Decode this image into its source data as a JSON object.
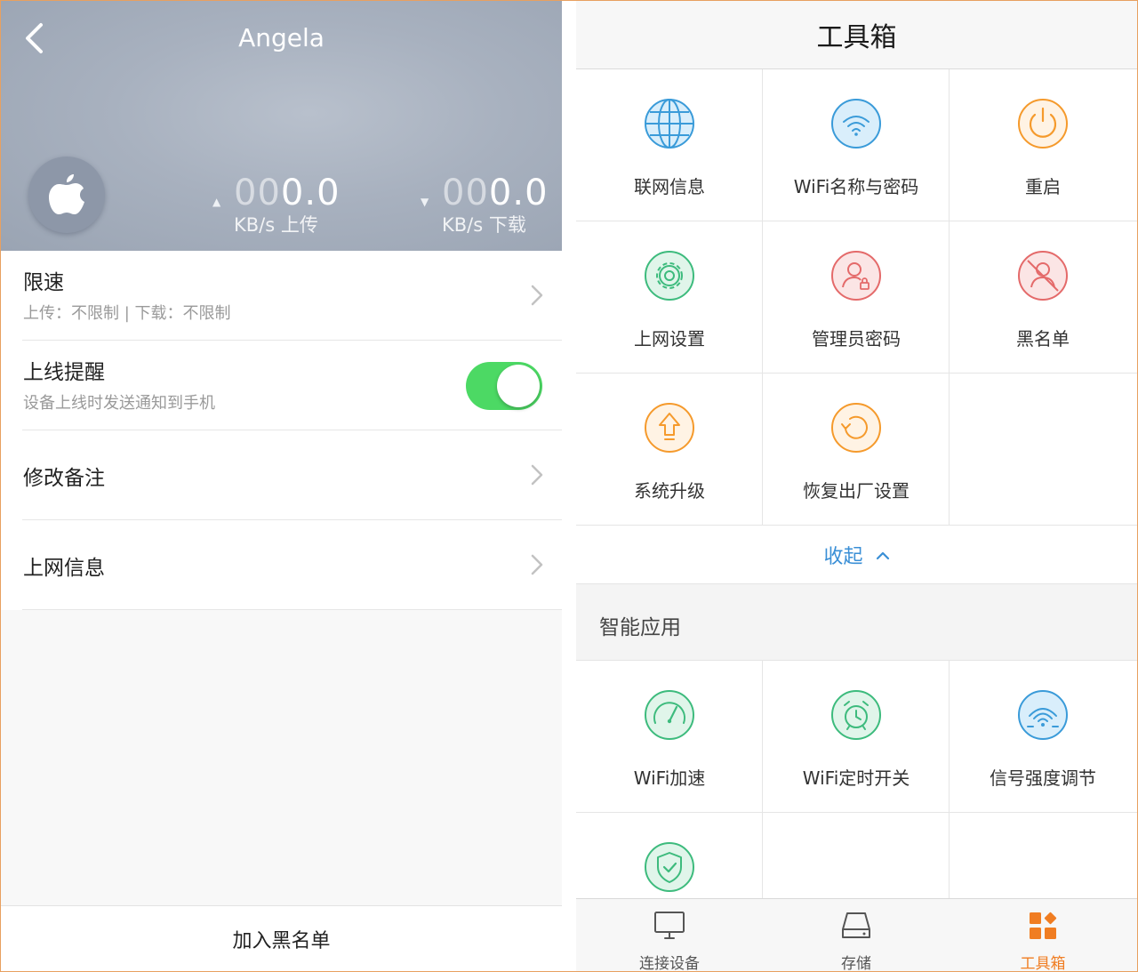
{
  "device_panel": {
    "title": "Angela",
    "upload": {
      "value_dim": "00",
      "value_main": "0.0",
      "unit": "KB/s 上传"
    },
    "download": {
      "value_dim": "00",
      "value_main": "0.0",
      "unit": "KB/s 下载"
    },
    "rows": {
      "speed_limit": {
        "title": "限速",
        "subtitle": "上传：不限制 | 下载：不限制"
      },
      "online_alert": {
        "title": "上线提醒",
        "subtitle": "设备上线时发送通知到手机",
        "enabled": true
      },
      "edit_note": {
        "title": "修改备注"
      },
      "net_info": {
        "title": "上网信息"
      }
    },
    "bottom_action": "加入黑名单"
  },
  "toolbox": {
    "title": "工具箱",
    "tools": [
      {
        "label": "联网信息",
        "icon": "globe-icon",
        "color": "#3a9bd9"
      },
      {
        "label": "WiFi名称与密码",
        "icon": "wifi-icon",
        "color": "#3a9bd9"
      },
      {
        "label": "重启",
        "icon": "power-icon",
        "color": "#f59a2c"
      },
      {
        "label": "上网设置",
        "icon": "gear-icon",
        "color": "#3dbb7d"
      },
      {
        "label": "管理员密码",
        "icon": "admin-lock-icon",
        "color": "#e46a6a"
      },
      {
        "label": "黑名单",
        "icon": "user-blocked-icon",
        "color": "#e46a6a"
      },
      {
        "label": "系统升级",
        "icon": "upgrade-arrow-icon",
        "color": "#f59a2c"
      },
      {
        "label": "恢复出厂设置",
        "icon": "restore-icon",
        "color": "#f59a2c"
      }
    ],
    "collapse_label": "收起",
    "smart_section_title": "智能应用",
    "smart_apps": [
      {
        "label": "WiFi加速",
        "icon": "speedometer-icon",
        "color": "#3dbb7d"
      },
      {
        "label": "WiFi定时开关",
        "icon": "alarm-clock-icon",
        "color": "#3dbb7d"
      },
      {
        "label": "信号强度调节",
        "icon": "signal-strength-icon",
        "color": "#3a9bd9"
      },
      {
        "label": "",
        "icon": "shield-check-icon",
        "color": "#3dbb7d"
      }
    ],
    "tabs": [
      {
        "label": "连接设备",
        "icon": "monitor-icon",
        "active": false
      },
      {
        "label": "存储",
        "icon": "storage-drive-icon",
        "active": false
      },
      {
        "label": "工具箱",
        "icon": "toolbox-icon",
        "active": true
      }
    ],
    "accent_color": "#f07d22",
    "link_color": "#3a8fd6"
  }
}
